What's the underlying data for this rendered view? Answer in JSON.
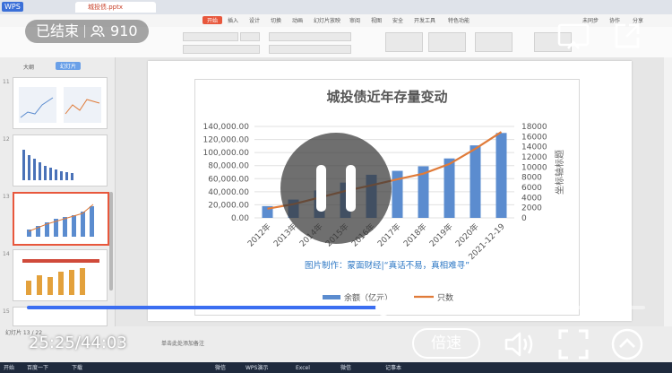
{
  "app": {
    "logo": "WPS",
    "document_tab": "城投债.pptx"
  },
  "menu": {
    "items": [
      "开始",
      "插入",
      "设计",
      "切换",
      "动画",
      "幻灯片放映",
      "审阅",
      "视图",
      "安全",
      "开发工具",
      "特色功能"
    ],
    "active_index": 0,
    "right_items": [
      "未同步",
      "协作",
      "分享"
    ]
  },
  "thumbnails": {
    "tabs": [
      "大纲",
      "幻灯片"
    ],
    "numbers": [
      "11",
      "12",
      "13",
      "14",
      "15"
    ],
    "selected_index": 2
  },
  "chart_data": {
    "type": "bar",
    "title": "城投债近年存量变动",
    "categories": [
      "2012年",
      "2013年",
      "2014年",
      "2015年",
      "2016年",
      "2017年",
      "2018年",
      "2019年",
      "2020年",
      "2021-12-19"
    ],
    "series": [
      {
        "name": "余额（亿元）",
        "type": "bar",
        "axis": "left",
        "color": "#5b8ccf",
        "values": [
          18000,
          28000,
          42000,
          54000,
          66000,
          72000,
          79000,
          91000,
          111000,
          130000
        ]
      },
      {
        "name": "只数",
        "type": "line",
        "axis": "right",
        "color": "#e07b39",
        "values": [
          1800,
          2700,
          4000,
          5300,
          6400,
          7600,
          8700,
          10600,
          13600,
          16900
        ]
      }
    ],
    "y_left": {
      "min": 0,
      "max": 140000,
      "ticks": [
        "0.00",
        "20,000.00",
        "40,000.00",
        "60,000.00",
        "80,000.00",
        "100,000.00",
        "120,000.00",
        "140,000.00"
      ]
    },
    "y_right": {
      "min": 0,
      "max": 18000,
      "ticks": [
        "0",
        "2000",
        "4000",
        "6000",
        "8000",
        "10000",
        "12000",
        "14000",
        "16000",
        "18000"
      ],
      "label": "坐标轴标题"
    },
    "grid": true,
    "legend": "bottom",
    "annotation": "图片制作：蒙面财经|“真话不易，真相难寻”"
  },
  "overlay": {
    "status": "已结束",
    "viewers": "910",
    "elapsed": "25:25",
    "total": "44:03",
    "progress": 0.577,
    "speed_label": "倍速"
  },
  "statusbar": {
    "left": "幻灯片 13 / 22",
    "note": "单击此处添加备注"
  },
  "taskbar": {
    "items": [
      "开始",
      "百度一下",
      "下载",
      "微信",
      "WPS演示",
      "Excel",
      "微信",
      "记事本"
    ]
  },
  "colors": {
    "accent": "#e8573c",
    "progress": "#3b6ef1"
  }
}
